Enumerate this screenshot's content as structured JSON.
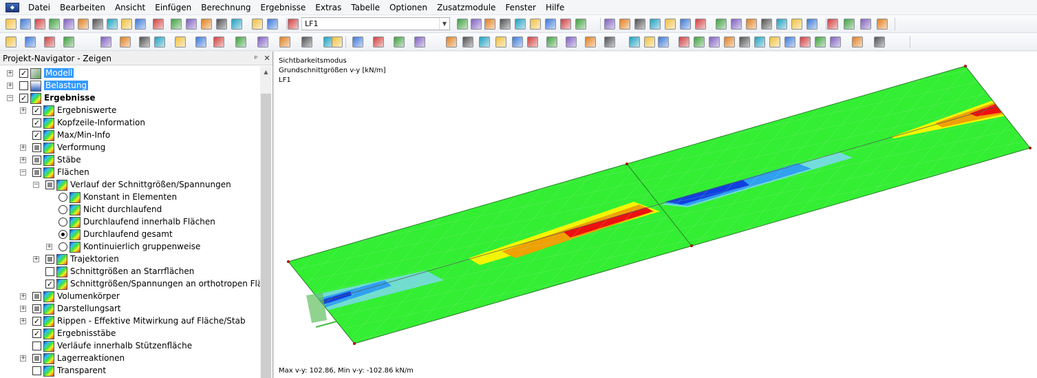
{
  "menu": {
    "items": [
      "Datei",
      "Bearbeiten",
      "Ansicht",
      "Einfügen",
      "Berechnung",
      "Ergebnisse",
      "Extras",
      "Tabelle",
      "Optionen",
      "Zusatzmodule",
      "Fenster",
      "Hilfe"
    ]
  },
  "toolbar": {
    "load_case": "LF1"
  },
  "navigator": {
    "title": "Projekt-Navigator - Zeigen",
    "pin": "ᵖ",
    "close": "✕",
    "items": [
      {
        "label": "Modell",
        "level": 0,
        "check": "checked",
        "expander": "+",
        "icon": "model-icon",
        "selected": true
      },
      {
        "label": "Belastung",
        "level": 0,
        "check": "empty",
        "expander": "+",
        "icon": "load-icon",
        "selected": true
      },
      {
        "label": "Ergebnisse",
        "level": 0,
        "check": "checked",
        "expander": "-",
        "icon": "results-icon",
        "bold": true
      },
      {
        "label": "Ergebniswerte",
        "level": 1,
        "check": "checked",
        "expander": "+",
        "icon": "results-icon"
      },
      {
        "label": "Kopfzeile-Information",
        "level": 1,
        "check": "checked",
        "expander": "",
        "icon": "results-icon"
      },
      {
        "label": "Max/Min-Info",
        "level": 1,
        "check": "checked",
        "expander": "",
        "icon": "results-icon"
      },
      {
        "label": "Verformung",
        "level": 1,
        "check": "partial",
        "expander": "+",
        "icon": "results-icon"
      },
      {
        "label": "Stäbe",
        "level": 1,
        "check": "partial",
        "expander": "+",
        "icon": "results-icon"
      },
      {
        "label": "Flächen",
        "level": 1,
        "check": "partial",
        "expander": "-",
        "icon": "results-icon"
      },
      {
        "label": "Verlauf der Schnittgrößen/Spannungen",
        "level": 2,
        "check": "partial",
        "expander": "-",
        "icon": "results-icon"
      },
      {
        "label": "Konstant in Elementen",
        "level": 3,
        "radio": "off",
        "expander": "",
        "icon": "results-icon"
      },
      {
        "label": "Nicht durchlaufend",
        "level": 3,
        "radio": "off",
        "expander": "",
        "icon": "results-icon"
      },
      {
        "label": "Durchlaufend innerhalb Flächen",
        "level": 3,
        "radio": "off",
        "expander": "",
        "icon": "results-icon"
      },
      {
        "label": "Durchlaufend gesamt",
        "level": 3,
        "radio": "on",
        "expander": "",
        "icon": "results-icon"
      },
      {
        "label": "Kontinuierlich gruppenweise",
        "level": 3,
        "radio": "off",
        "expander": "+",
        "icon": "results-icon"
      },
      {
        "label": "Trajektorien",
        "level": 2,
        "check": "partial",
        "expander": "+",
        "icon": "results-icon"
      },
      {
        "label": "Schnittgrößen an Starrflächen",
        "level": 2,
        "check": "empty",
        "expander": "",
        "icon": "results-icon"
      },
      {
        "label": "Schnittgrößen/Spannungen an orthotropen Flächen",
        "level": 2,
        "check": "checked",
        "expander": "",
        "icon": "results-icon"
      },
      {
        "label": "Volumenkörper",
        "level": 1,
        "check": "partial",
        "expander": "+",
        "icon": "results-icon"
      },
      {
        "label": "Darstellungsart",
        "level": 1,
        "check": "partial",
        "expander": "+",
        "icon": "results-icon"
      },
      {
        "label": "Rippen - Effektive Mitwirkung auf Fläche/Stab",
        "level": 1,
        "check": "checked",
        "expander": "+",
        "icon": "results-icon"
      },
      {
        "label": "Ergebnisstäbe",
        "level": 1,
        "check": "checked",
        "expander": "",
        "icon": "results-icon"
      },
      {
        "label": "Verläufe innerhalb Stützenfläche",
        "level": 1,
        "check": "empty",
        "expander": "",
        "icon": "results-icon"
      },
      {
        "label": "Lagerreaktionen",
        "level": 1,
        "check": "partial",
        "expander": "+",
        "icon": "results-icon"
      },
      {
        "label": "Transparent",
        "level": 1,
        "check": "empty",
        "expander": "",
        "icon": "results-icon"
      }
    ]
  },
  "viewport": {
    "line1": "Sichtbarkeitsmodus",
    "line2": "Grundschnittgrößen v-y [kN/m]",
    "line3": "LF1",
    "footer": "Max v-y: 102.86, Min v-y: -102.86 kN/m",
    "colors": {
      "green": "#33ee33",
      "yellow": "#f5f500",
      "orange": "#f0a000",
      "red": "#ee1010",
      "blue": "#1040e0",
      "cyan": "#30b0f0"
    }
  }
}
